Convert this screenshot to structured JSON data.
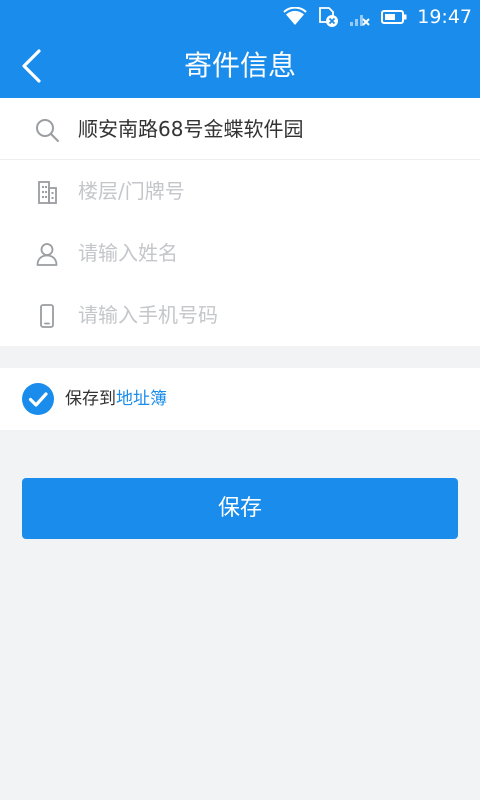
{
  "status_bar": {
    "time": "19:47",
    "icons": [
      "wifi-icon",
      "sim-icon",
      "signal-icon",
      "battery-icon"
    ]
  },
  "navbar": {
    "title": "寄件信息",
    "back_icon": "chevron-left-icon"
  },
  "form": {
    "address": {
      "value": "顺安南路68号金蝶软件园",
      "icon": "search-icon"
    },
    "floor": {
      "placeholder": "楼层/门牌号",
      "icon": "building-icon"
    },
    "name": {
      "placeholder": "请输入姓名",
      "icon": "person-icon"
    },
    "phone": {
      "placeholder": "请输入手机号码",
      "icon": "phone-icon"
    }
  },
  "save_to_book": {
    "checked": true,
    "prefix": "保存到",
    "link": "地址簿",
    "icon": "check-circle-icon"
  },
  "save_button": {
    "label": "保存"
  },
  "colors": {
    "primary": "#1a8ceb",
    "background": "#f2f3f5",
    "placeholder": "#c4c6c9",
    "text": "#333333"
  }
}
